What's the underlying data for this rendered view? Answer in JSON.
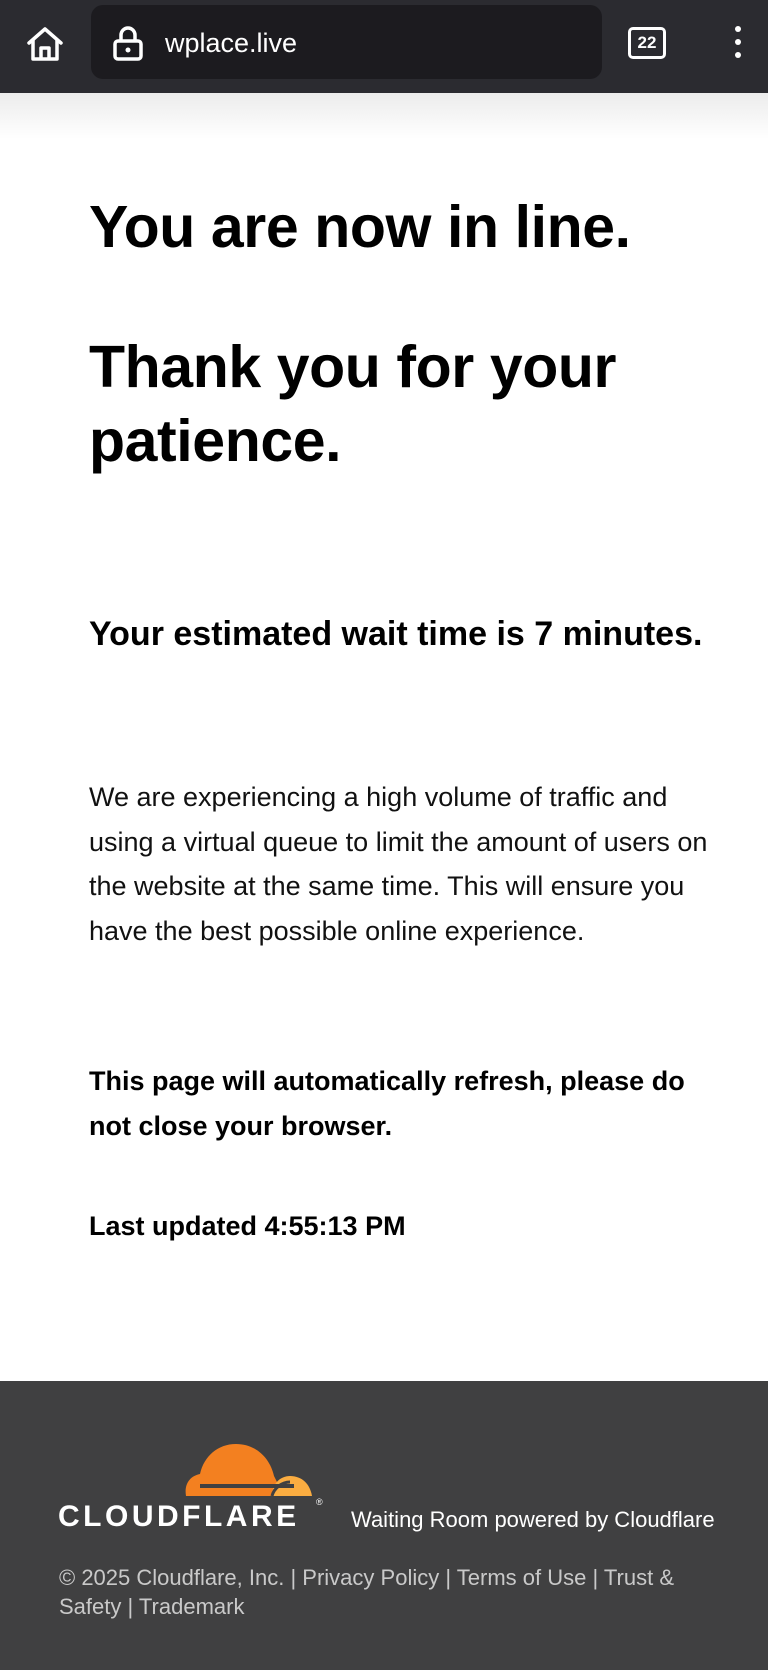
{
  "browser": {
    "url": "wplace.live",
    "tab_count": "22",
    "icons": {
      "home": "home-icon",
      "lock": "lock-icon",
      "tabs": "tabs-icon",
      "menu": "more-vert-icon"
    }
  },
  "main": {
    "heading_line1": "You are now in line.",
    "heading_line2": "Thank you for your patience.",
    "wait_time": "Your estimated wait time is 7 minutes.",
    "description": "We are experiencing a high volume of traffic and using a virtual queue to limit the amount of users on the website at the same time. This will ensure you have the best possible online experience.",
    "refresh_notice": "This page will automatically refresh, please do not close your browser.",
    "last_updated": "Last updated 4:55:13 PM"
  },
  "footer": {
    "logo_text": "CLOUDFLARE",
    "logo_reg": "®",
    "powered_by": "Waiting Room powered by Cloudflare",
    "copyright": "© 2025 Cloudflare, Inc.",
    "separator": " | ",
    "links": [
      "Privacy Policy",
      "Terms of Use",
      "Trust & Safety",
      "Trademark"
    ]
  },
  "colors": {
    "topbar_bg": "#2b2b30",
    "urlbar_bg": "#1c1b1f",
    "footer_bg": "#404041",
    "cloud_orange": "#f38020",
    "cloud_light_orange": "#fbad41"
  }
}
